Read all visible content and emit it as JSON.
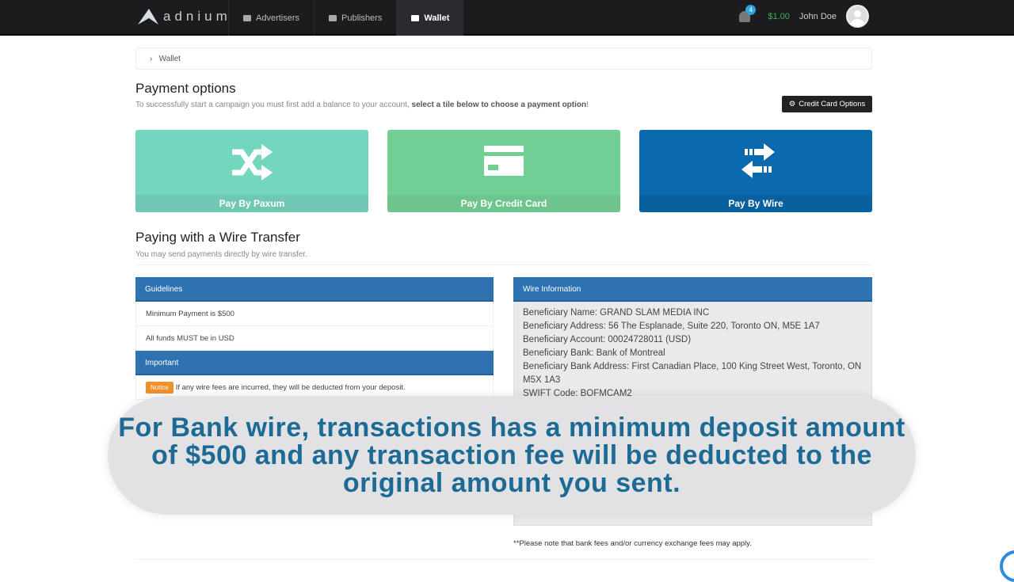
{
  "topbar": {
    "logo": "adnium",
    "nav": [
      {
        "label": "Advertisers",
        "icon": "id-card-icon"
      },
      {
        "label": "Publishers",
        "icon": "briefcase-icon"
      },
      {
        "label": "Wallet",
        "icon": "wallet-icon",
        "active": true
      }
    ],
    "notifications": "4",
    "balance": "$1.00",
    "user": "John Doe"
  },
  "breadcrumb": {
    "item": "Wallet"
  },
  "payment": {
    "title": "Payment options",
    "subtitle_pre": "To successfully start a campaign you must first add a balance to your account, ",
    "subtitle_bold": "select a tile below to choose a payment option",
    "subtitle_post": "!",
    "cc_button": "Credit Card Options",
    "tiles": [
      {
        "label": "Pay By Paxum",
        "color": "#74d6bd",
        "icon": "shuffle-icon"
      },
      {
        "label": "Pay By Credit Card",
        "color": "#72cf94",
        "icon": "credit-card-icon"
      },
      {
        "label": "Pay By Wire",
        "color": "#0a6aad",
        "icon": "exchange-icon"
      }
    ]
  },
  "wire": {
    "title": "Paying with a Wire Transfer",
    "subtitle": "You may send payments directly by wire transfer.",
    "guidelines_title": "Guidelines",
    "guidelines": [
      "Minimum Payment is $500",
      "All funds MUST be in USD"
    ],
    "important_title": "Important",
    "notice_badge": "Notice",
    "notice_text": "If any wire fees are incurred, they will be deducted from your deposit.",
    "info_title": "Wire Information",
    "info": [
      "Beneficiary Name: GRAND SLAM MEDIA INC",
      "Beneficiary Address: 56 The Esplanade, Suite 220, Toronto ON, M5E 1A7",
      "Beneficiary Account: 00024728011 (USD)",
      "Beneficiary Bank: Bank of Montreal",
      "Beneficiary Bank Address: First Canadian Place, 100 King Street West, Toronto, ON M5X 1A3",
      "SWIFT Code: BOFMCAM2"
    ],
    "note": "**Please note that bank fees and/or currency exchange fees may apply."
  },
  "caption": "For Bank wire, transactions has a minimum deposit amount of $500 and any transaction fee will be deducted to the original amount you sent."
}
